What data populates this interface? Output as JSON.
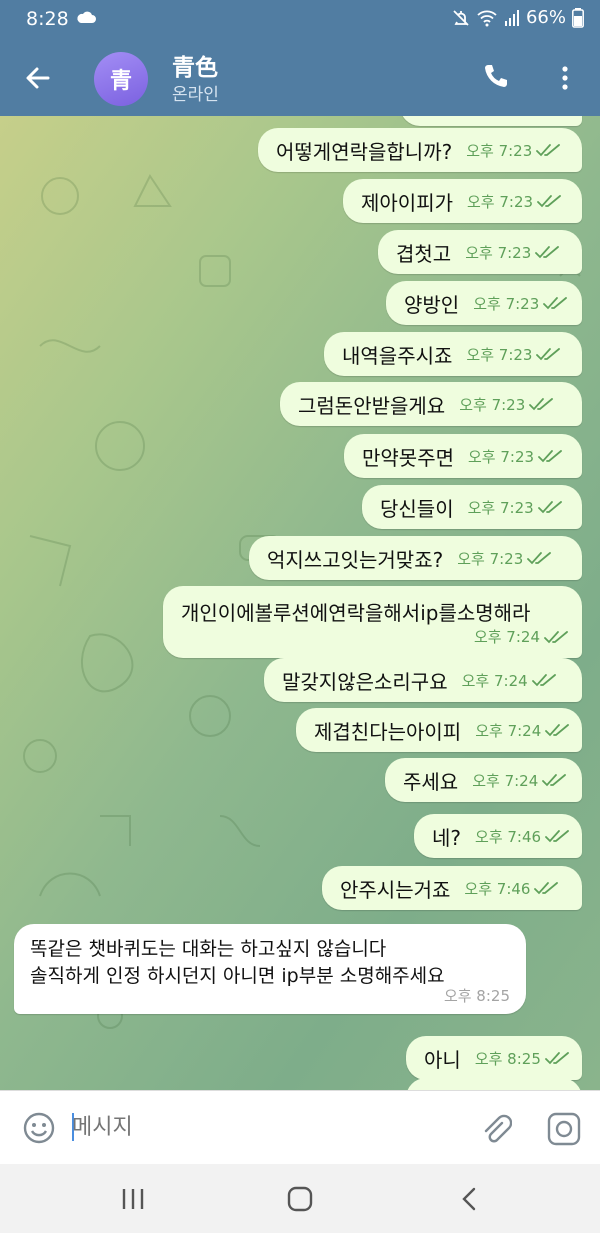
{
  "status_bar": {
    "time": "8:28",
    "battery": "66%",
    "icons": [
      "cloud-icon",
      "mute-icon",
      "wifi-icon",
      "signal-icon",
      "battery-icon"
    ]
  },
  "header": {
    "avatar_letter": "青",
    "title": "青色",
    "subtitle": "온라인",
    "icons": [
      "back-arrow-icon",
      "phone-icon",
      "more-vert-icon"
    ]
  },
  "messages": [
    {
      "text": "어떻게연락을합니까?",
      "time": "오후 7:23"
    },
    {
      "text": "제아이피가",
      "time": "오후 7:23"
    },
    {
      "text": "겹첫고",
      "time": "오후 7:23"
    },
    {
      "text": "양방인",
      "time": "오후 7:23"
    },
    {
      "text": "내역을주시죠",
      "time": "오후 7:23"
    },
    {
      "text": "그럼돈안받을게요",
      "time": "오후 7:23"
    },
    {
      "text": "만약못주면",
      "time": "오후 7:23"
    },
    {
      "text": "당신들이",
      "time": "오후 7:23"
    },
    {
      "text": "억지쓰고잇는거맞죠?",
      "time": "오후 7:23"
    },
    {
      "text": "개인이에볼루션에연락을해서ip를소명해라",
      "time": "오후 7:24"
    },
    {
      "text": "말갖지않은소리구요",
      "time": "오후 7:24"
    },
    {
      "text": "제겹친다는아이피",
      "time": "오후 7:24"
    },
    {
      "text": "주세요",
      "time": "오후 7:24"
    },
    {
      "text": "네?",
      "time": "오후 7:46"
    },
    {
      "text": "안주시는거죠",
      "time": "오후 7:46"
    },
    {
      "text": "아니",
      "time": "오후 8:25"
    }
  ],
  "incoming": {
    "line1": "똑같은 챗바퀴도는 대화는 하고싶지 않습니다",
    "line2": "솔직하게 인정 하시던지 아니면 ip부분 소명해주세요",
    "time": "오후 8:25"
  },
  "input": {
    "placeholder": "메시지",
    "icons": [
      "emoji-icon",
      "attach-icon",
      "camera-icon"
    ]
  },
  "nav": {
    "icons": [
      "recents-icon",
      "home-icon",
      "back-icon"
    ]
  },
  "colors": {
    "header": "#517da2",
    "outgoing_bubble": "#effdde",
    "incoming_bubble": "#ffffff",
    "check": "#5fa05a"
  }
}
